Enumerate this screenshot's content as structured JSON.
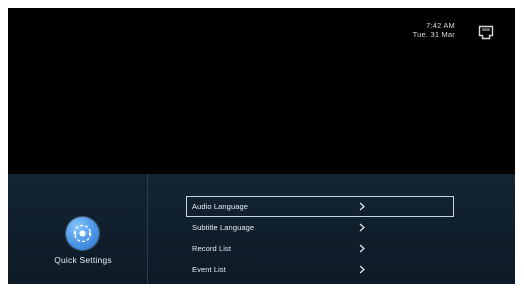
{
  "status": {
    "time": "7:42 AM",
    "date": "Tue. 31 Mar",
    "network_icon": "ethernet-icon"
  },
  "quick_settings": {
    "label": "Quick Settings",
    "icon": "quick-settings-icon",
    "accent_color": "#4a94e6"
  },
  "menu": {
    "items": [
      {
        "label": "Audio Language",
        "selected": true
      },
      {
        "label": "Subtitle Language",
        "selected": false
      },
      {
        "label": "Record List",
        "selected": false
      },
      {
        "label": "Event List",
        "selected": false
      }
    ],
    "chevron_icon": "chevron-right-icon"
  }
}
